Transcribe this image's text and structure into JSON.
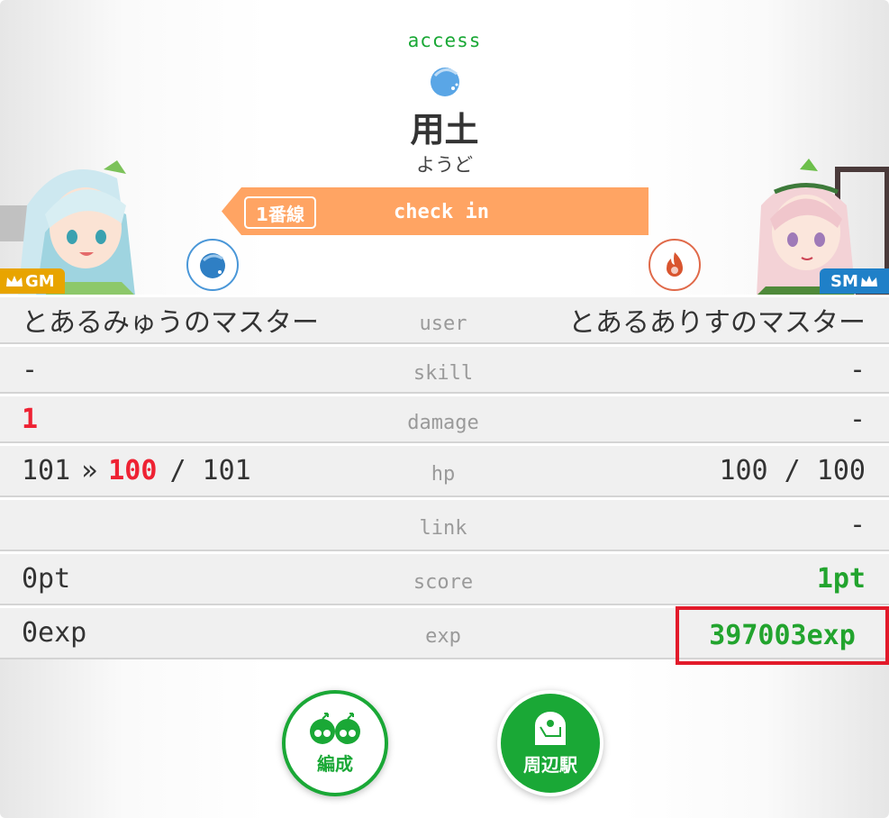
{
  "header": {
    "access_label": "access",
    "station_name": "用土",
    "station_reading": "ようど",
    "line_badge": "1番線",
    "checkin_label": "check in"
  },
  "players": {
    "left": {
      "rank": "GM",
      "attribute_icon": "water-drop-icon",
      "attribute_color": "#4a97d8"
    },
    "right": {
      "rank": "SM",
      "attribute_icon": "fire-icon",
      "attribute_color": "#e06a4a"
    }
  },
  "table": {
    "user": {
      "label": "user",
      "left": "とあるみゅうのマスター",
      "right": "とあるありすのマスター"
    },
    "skill": {
      "label": "skill",
      "left": "-",
      "right": "-"
    },
    "damage": {
      "label": "damage",
      "left": "1",
      "right": "-"
    },
    "hp": {
      "label": "hp",
      "left_before": "101",
      "arrow": "»",
      "left_after": "100",
      "left_max": "/ 101",
      "right": "100 / 100"
    },
    "link": {
      "label": "link",
      "left": "",
      "right": "-"
    },
    "score": {
      "label": "score",
      "left": "0pt",
      "right": "1pt"
    },
    "exp": {
      "label": "exp",
      "left": "0exp",
      "right": "397003exp"
    }
  },
  "buttons": {
    "formation": "編成",
    "nearby_stations": "周辺駅"
  },
  "colors": {
    "accent_green": "#1aa836",
    "banner_orange": "#ffa463",
    "highlight_red": "#e21a2a",
    "damage_red": "#ee2233",
    "gm_badge": "#e8a400",
    "sm_badge": "#1f80c8"
  }
}
